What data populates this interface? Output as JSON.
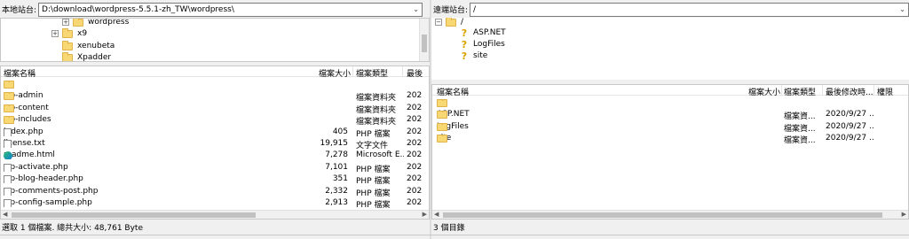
{
  "local": {
    "path_label": "本地站台:",
    "path_value": "D:\\download\\wordpress-5.5.1-zh_TW\\wordpress\\",
    "tree": [
      "wordpress",
      "x9",
      "xenubeta",
      "Xpadder"
    ],
    "columns": {
      "name": "檔案名稱",
      "size": "檔案大小",
      "type": "檔案類型",
      "modified": "最後"
    },
    "files": [
      {
        "icon": "folder",
        "name": "..",
        "size": "",
        "type": "",
        "mod": ""
      },
      {
        "icon": "folder",
        "name": "wp-admin",
        "size": "",
        "type": "檔案資料夾",
        "mod": "202"
      },
      {
        "icon": "folder",
        "name": "wp-content",
        "size": "",
        "type": "檔案資料夾",
        "mod": "202"
      },
      {
        "icon": "folder",
        "name": "wp-includes",
        "size": "",
        "type": "檔案資料夾",
        "mod": "202"
      },
      {
        "icon": "file",
        "name": "index.php",
        "size": "405",
        "type": "PHP 檔案",
        "mod": "202"
      },
      {
        "icon": "file",
        "name": "license.txt",
        "size": "19,915",
        "type": "文字文件",
        "mod": "202"
      },
      {
        "icon": "edge",
        "name": "readme.html",
        "size": "7,278",
        "type": "Microsoft E...",
        "mod": "202"
      },
      {
        "icon": "file",
        "name": "wp-activate.php",
        "size": "7,101",
        "type": "PHP 檔案",
        "mod": "202"
      },
      {
        "icon": "file",
        "name": "wp-blog-header.php",
        "size": "351",
        "type": "PHP 檔案",
        "mod": "202"
      },
      {
        "icon": "file",
        "name": "wp-comments-post.php",
        "size": "2,332",
        "type": "PHP 檔案",
        "mod": "202"
      },
      {
        "icon": "file",
        "name": "wp-config-sample.php",
        "size": "2,913",
        "type": "PHP 檔案",
        "mod": "202"
      }
    ],
    "status": "選取 1 個檔案. 總共大小: 48,761 Byte"
  },
  "remote": {
    "path_label": "遠端站台:",
    "path_value": "/",
    "tree_root": "/",
    "tree": [
      "ASP.NET",
      "LogFiles",
      "site"
    ],
    "columns": {
      "name": "檔案名稱",
      "size": "檔案大小",
      "type": "檔案類型",
      "modified": "最後修改時...",
      "perm": "權限"
    },
    "files": [
      {
        "name": "..",
        "type": "",
        "mod": ""
      },
      {
        "name": "ASP.NET",
        "type": "檔案資...",
        "mod": "2020/9/27 ..."
      },
      {
        "name": "LogFiles",
        "type": "檔案資...",
        "mod": "2020/9/27 ..."
      },
      {
        "name": "site",
        "type": "檔案資...",
        "mod": "2020/9/27 ..."
      }
    ],
    "status": "3 個目錄"
  }
}
